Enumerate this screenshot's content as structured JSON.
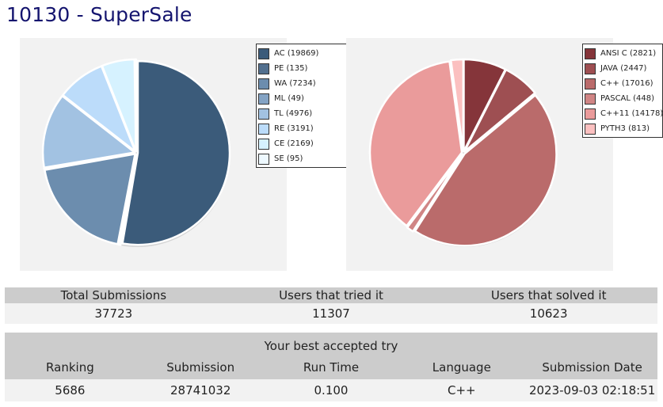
{
  "page": {
    "title": "10130 - SuperSale"
  },
  "status_chart": {
    "legend": [
      {
        "label": "AC (19869)",
        "color": "#3b5b7a"
      },
      {
        "label": "PE (135)",
        "color": "#52708f"
      },
      {
        "label": "WA (7234)",
        "color": "#6c8dae"
      },
      {
        "label": "ML (49)",
        "color": "#84a3c4"
      },
      {
        "label": "TL (4976)",
        "color": "#a2c2e2"
      },
      {
        "label": "RE (3191)",
        "color": "#bcdcfa"
      },
      {
        "label": "CE (2169)",
        "color": "#d6f2ff"
      },
      {
        "label": "SE (95)",
        "color": "#eef9ff"
      }
    ]
  },
  "language_chart": {
    "legend": [
      {
        "label": "ANSI C (2821)",
        "color": "#85353a"
      },
      {
        "label": "JAVA (2447)",
        "color": "#9e4f52"
      },
      {
        "label": "C++ (17016)",
        "color": "#ba6b6b"
      },
      {
        "label": "PASCAL (448)",
        "color": "#d08585"
      },
      {
        "label": "C++11 (14178)",
        "color": "#ea9b9b"
      },
      {
        "label": "PYTH3 (813)",
        "color": "#fbc0c0"
      }
    ]
  },
  "stats": {
    "headers": [
      "Total Submissions",
      "Users that tried it",
      "Users that solved it"
    ],
    "values": [
      "37723",
      "11307",
      "10623"
    ]
  },
  "best_try": {
    "caption": "Your best accepted try",
    "headers": [
      "Ranking",
      "Submission",
      "Run Time",
      "Language",
      "Submission Date"
    ],
    "values": [
      "5686",
      "28741032",
      "0.100",
      "C++",
      "2023-09-03 02:18:51"
    ]
  }
}
